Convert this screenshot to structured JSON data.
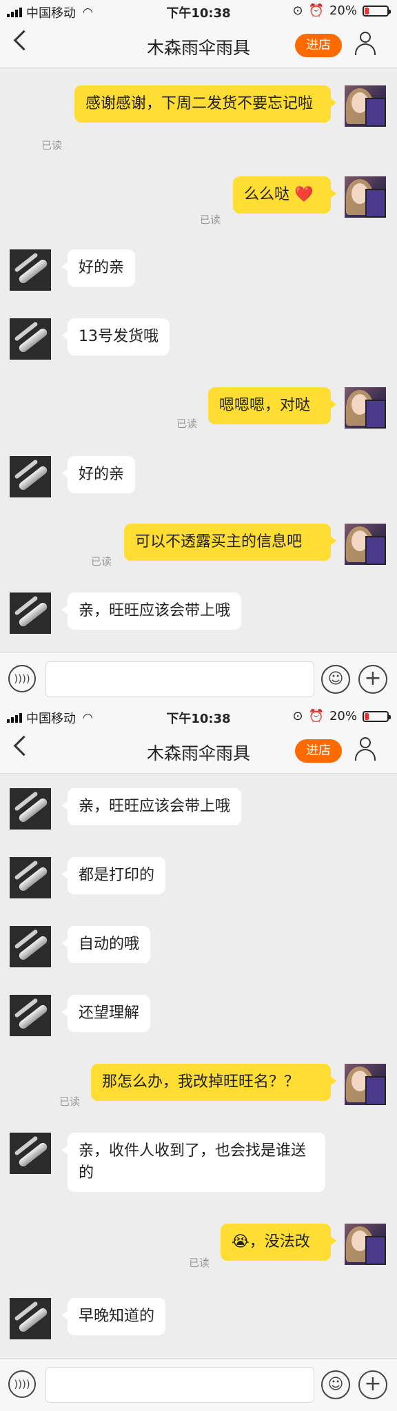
{
  "status_bar": {
    "carrier": "中国移动",
    "time": "下午10:38",
    "battery": "20%",
    "battery_level": 0.2,
    "battery_color": "#f0302e"
  },
  "nav": {
    "title": "木森雨伞雨具",
    "shop_button": "进店"
  },
  "read_label": "已读",
  "screens": [
    {
      "messages": [
        {
          "from": "me",
          "text": "感谢感谢，下周二发货不要忘记啦",
          "read": "已读"
        },
        {
          "from": "me",
          "text": "么么哒 ❤️",
          "read": "已读"
        },
        {
          "from": "seller",
          "text": "好的亲"
        },
        {
          "from": "seller",
          "text": "13号发货哦"
        },
        {
          "from": "me",
          "text": "嗯嗯嗯，对哒",
          "read": "已读"
        },
        {
          "from": "seller",
          "text": "好的亲"
        },
        {
          "from": "me",
          "text": "可以不透露买主的信息吧",
          "read": "已读"
        },
        {
          "from": "seller",
          "text": "亲，旺旺应该会带上哦"
        }
      ]
    },
    {
      "messages": [
        {
          "from": "seller",
          "text": "亲，旺旺应该会带上哦"
        },
        {
          "from": "seller",
          "text": "都是打印的"
        },
        {
          "from": "seller",
          "text": "自动的哦"
        },
        {
          "from": "seller",
          "text": "还望理解"
        },
        {
          "from": "me",
          "text": "那怎么办，我改掉旺旺名？？",
          "read": "已读"
        },
        {
          "from": "seller",
          "text": "亲，收件人收到了，也会找是谁送的"
        },
        {
          "from": "me",
          "text": "😭，没法改",
          "read": "已读"
        },
        {
          "from": "seller",
          "text": "早晚知道的"
        }
      ]
    }
  ],
  "colors": {
    "accent": "#ff6a00",
    "my_bubble": "#ffdd33",
    "seller_bubble": "#ffffff",
    "background": "#ededed"
  },
  "icons": {
    "back": "chevron-left-icon",
    "profile": "person-icon",
    "voice": "voice-icon",
    "emoji": "emoji-icon",
    "more": "plus-icon"
  }
}
